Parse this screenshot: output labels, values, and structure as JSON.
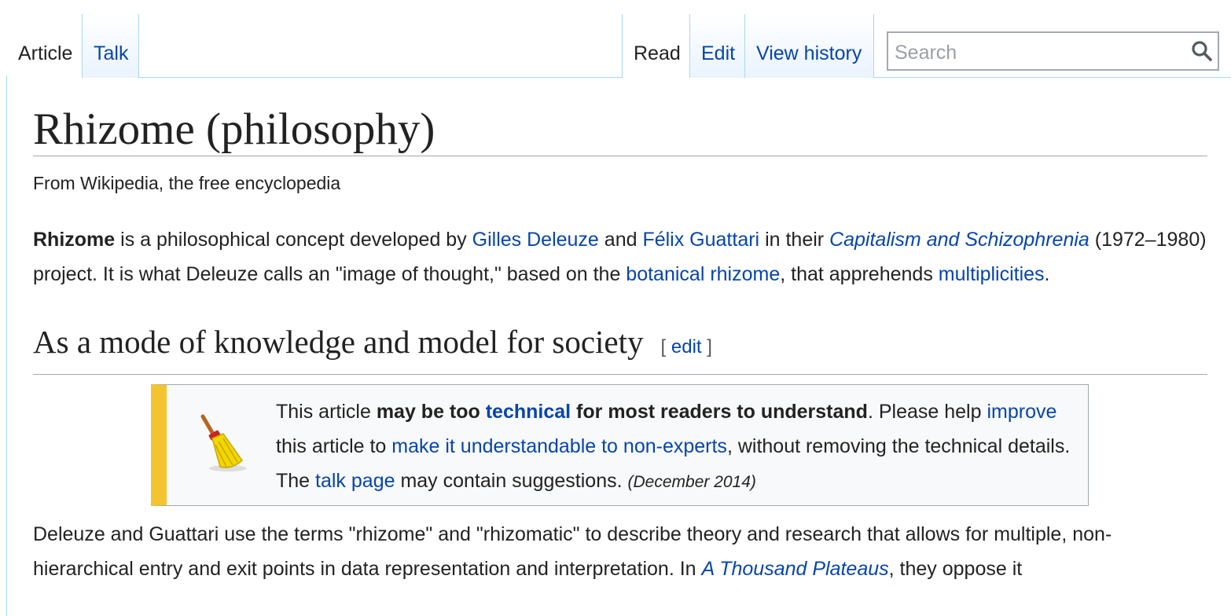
{
  "tabs_left": [
    {
      "label": "Article",
      "selected": true
    },
    {
      "label": "Talk",
      "selected": false
    }
  ],
  "tabs_right": [
    {
      "label": "Read",
      "selected": true
    },
    {
      "label": "Edit",
      "selected": false
    },
    {
      "label": "View history",
      "selected": false
    }
  ],
  "search": {
    "placeholder": "Search",
    "icon": "search-icon"
  },
  "title": "Rhizome (philosophy)",
  "tagline": "From Wikipedia, the free encyclopedia",
  "intro": {
    "bold": "Rhizome",
    "t1": " is a philosophical concept developed by ",
    "link1": "Gilles Deleuze",
    "t2": " and ",
    "link2": "Félix Guattari",
    "t3": " in their ",
    "link3": "Capitalism and Schizophrenia",
    "t4": " (1972–1980) project. It is what Deleuze calls an \"image of thought,\" based on the ",
    "link4": "botanical rhizome",
    "t5": ", that apprehends ",
    "link5": "multiplicities",
    "t6": "."
  },
  "section": {
    "heading": "As a mode of knowledge and model for society",
    "edit_open": "[ ",
    "edit_label": "edit",
    "edit_close": " ]"
  },
  "notice": {
    "icon": "broom-icon",
    "t1": "This article ",
    "b1": "may be too ",
    "link1": "technical",
    "b2": " for most readers to understand",
    "t2": ". Please help ",
    "link2": "improve",
    "t3": " this article to ",
    "link3": "make it understandable to non-experts",
    "t4": ", without removing the technical details. The ",
    "link4": "talk page",
    "t5": " may contain suggestions. ",
    "date": "(December 2014)",
    "accent_color": "#f4c430"
  },
  "body": {
    "t1": "Deleuze and Guattari use the terms \"rhizome\" and \"rhizomatic\" to describe theory and research that allows for multiple, non-hierarchical entry and exit points in data representation and interpretation. In ",
    "link1": "A Thousand Plateaus",
    "t2": ", they oppose it"
  },
  "colors": {
    "link": "#0645ad",
    "tab_border": "#a7d7f9"
  }
}
